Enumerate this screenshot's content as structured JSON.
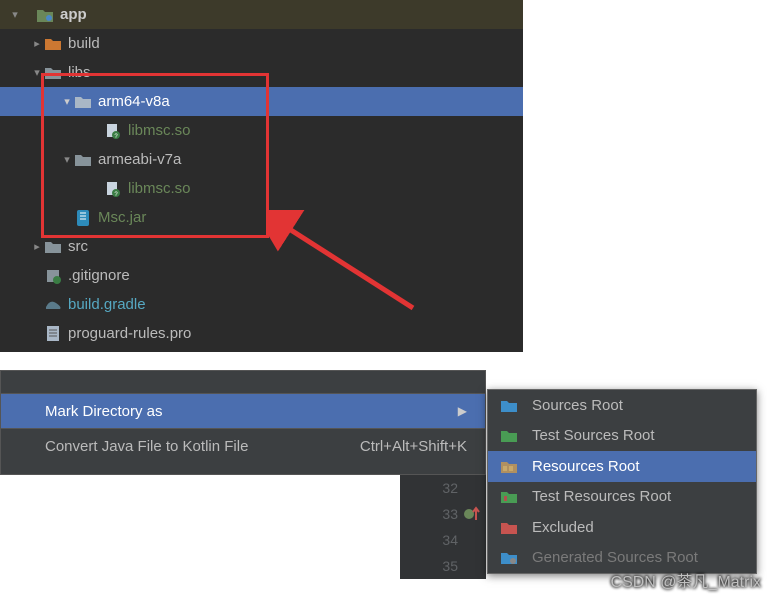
{
  "tree": {
    "app": "app",
    "build": "build",
    "libs": "libs",
    "arm64": "arm64-v8a",
    "lib1": "libmsc.so",
    "armeabi": "armeabi-v7a",
    "lib2": "libmsc.so",
    "mscjar": "Msc.jar",
    "src": "src",
    "gitignore": ".gitignore",
    "buildgradle": "build.gradle",
    "proguard": "proguard-rules.pro"
  },
  "menu": {
    "mark": "Mark Directory as",
    "convert": "Convert Java File to Kotlin File",
    "convert_sc": "Ctrl+Alt+Shift+K"
  },
  "lines": {
    "l1": "32",
    "l2": "33",
    "l3": "34",
    "l4": "35"
  },
  "submenu": {
    "sources": "Sources Root",
    "test_sources": "Test Sources Root",
    "resources": "Resources Root",
    "test_resources": "Test Resources Root",
    "excluded": "Excluded",
    "generated": "Generated Sources Root"
  },
  "watermark": "CSDN @茶凡_Matrix"
}
